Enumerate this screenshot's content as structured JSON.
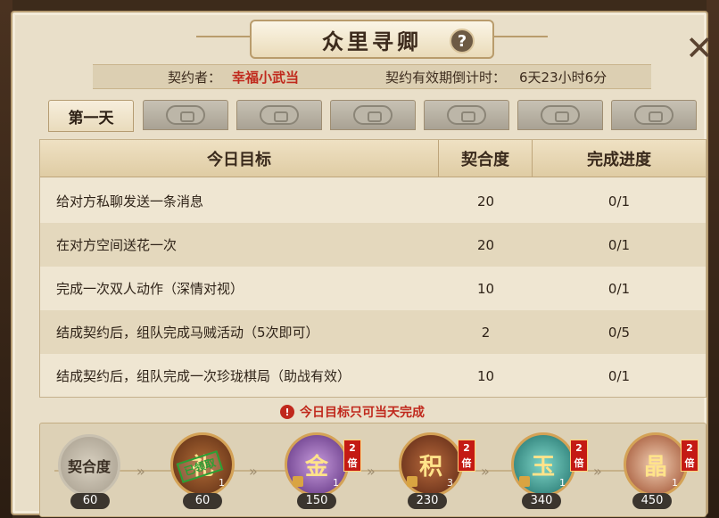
{
  "title": "众里寻卿",
  "help_label": "?",
  "close_label": "✕",
  "info": {
    "contractor_label": "契约者：",
    "contractor_name": "幸福小武当",
    "countdown_label": "契约有效期倒计时：",
    "countdown_value": "6天23小时6分"
  },
  "tabs": [
    {
      "label": "第一天",
      "active": true,
      "icon": "none"
    },
    {
      "label": "",
      "active": false,
      "icon": "lock-icon"
    },
    {
      "label": "",
      "active": false,
      "icon": "lock-icon"
    },
    {
      "label": "",
      "active": false,
      "icon": "lock-icon"
    },
    {
      "label": "",
      "active": false,
      "icon": "lock-icon"
    },
    {
      "label": "",
      "active": false,
      "icon": "lock-icon"
    },
    {
      "label": "",
      "active": false,
      "icon": "lock-icon"
    }
  ],
  "table": {
    "headers": [
      "今日目标",
      "契合度",
      "完成进度"
    ],
    "rows": [
      {
        "goal": "给对方私聊发送一条消息",
        "score": "20",
        "progress": "0/1"
      },
      {
        "goal": "在对方空间送花一次",
        "score": "20",
        "progress": "0/1"
      },
      {
        "goal": "完成一次双人动作（深情对视）",
        "score": "10",
        "progress": "0/1"
      },
      {
        "goal": "结成契约后，组队完成马贼活动（5次即可）",
        "score": "2",
        "progress": "0/5"
      },
      {
        "goal": "结成契约后，组队完成一次珍珑棋局（助战有效）",
        "score": "10",
        "progress": "0/1"
      }
    ]
  },
  "notice": "今日目标只可当天完成",
  "rewards": {
    "start": {
      "label": "契合度",
      "value": "60"
    },
    "items": [
      {
        "threshold": "60",
        "count": "1",
        "glyph": "礼",
        "double": false,
        "stamp": "已领取",
        "locked": false
      },
      {
        "threshold": "150",
        "count": "1",
        "glyph": "金",
        "double": true,
        "double_label": "2倍",
        "locked": true
      },
      {
        "threshold": "230",
        "count": "3",
        "glyph": "积",
        "double": true,
        "double_label": "2倍",
        "locked": true
      },
      {
        "threshold": "340",
        "count": "1",
        "glyph": "玉",
        "double": true,
        "double_label": "2倍",
        "locked": true
      },
      {
        "threshold": "450",
        "count": "1",
        "glyph": "晶",
        "double": true,
        "double_label": "2倍",
        "locked": true
      }
    ]
  },
  "colors": {
    "accent_red": "#c0281c",
    "panel": "#e9dfc9",
    "claimed_green": "#2ba034"
  }
}
